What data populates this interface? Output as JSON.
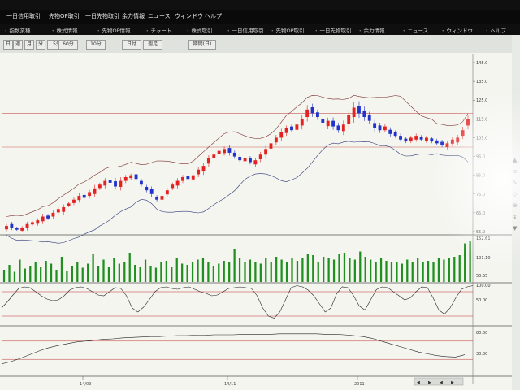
{
  "menu_top": {
    "items": [
      "一日信用取引",
      "先物OP取引",
      "一日先物取引",
      "余力情報",
      "ニュース",
      "ウィンドウ",
      "ヘルプ"
    ]
  },
  "menu_sub": {
    "items": [
      "指数業種",
      "株式情報",
      "先物OP情報",
      "チャート",
      "株式取引",
      "一日信用取引",
      "先物OP取引",
      "一日先物取引",
      "余力情報",
      "ニュース",
      "ウィンドウ",
      "ヘルプ"
    ]
  },
  "toolbar": {
    "buttons": [
      "日",
      "週",
      "月",
      "分",
      "5分",
      "60分",
      "10分",
      "日付",
      "週足"
    ],
    "right_label": "期間(日)"
  },
  "axis": {
    "price_ticks": [
      "145.0",
      "135.0",
      "125.0",
      "115.0",
      "105.0",
      "95.0",
      "85.0",
      "75.0",
      "65.0",
      "55.0"
    ],
    "volume_ticks": [
      "152.61",
      "101.10",
      "50.55"
    ],
    "osc1_ticks": [
      "100.00",
      "50.00"
    ],
    "osc2_ticks": [
      "80.00",
      "30.00"
    ],
    "date_labels": [
      "14/09",
      "14/11",
      "2011"
    ]
  },
  "colors": {
    "up": "#e52222",
    "down": "#2233cc",
    "band": "#333333",
    "volume": "#1f8f1f",
    "grid_red": "#c03030"
  },
  "chart_data": [
    {
      "type": "candlestick",
      "series": [
        {
          "name": "",
          "values": [
            58,
            57,
            56,
            57,
            59,
            60,
            61,
            63,
            62,
            65,
            67,
            68,
            70,
            72,
            74,
            73,
            76,
            78,
            80,
            82,
            81,
            79,
            82,
            84,
            85,
            83,
            80,
            77,
            75,
            72,
            74,
            77,
            80,
            82,
            84,
            83,
            85,
            88,
            90,
            94,
            96,
            98,
            99,
            97,
            95,
            93,
            94,
            92,
            93,
            96,
            99,
            102,
            105,
            108,
            110,
            109,
            112,
            115,
            120,
            118,
            116,
            113,
            114,
            111,
            109,
            112,
            117,
            121,
            118,
            116,
            114,
            110,
            109,
            111,
            107,
            106,
            104,
            103,
            105,
            106,
            104,
            105,
            103,
            102,
            101,
            102,
            104,
            105,
            109,
            115
          ]
        },
        {
          "name": "",
          "values": [
            1.8,
            2,
            1,
            1.5,
            2.2,
            1.2,
            1.8,
            2.5,
            1.5,
            2,
            1.8,
            2.5,
            1.2,
            1.8,
            2.2,
            1.5,
            2,
            3,
            1.8,
            2.5,
            1.5,
            2.8,
            3.2,
            2,
            1.5,
            2.5,
            2,
            1.8,
            2.5,
            1.5,
            2,
            2.2,
            1.8,
            2.5,
            2,
            1.8,
            2.2,
            2.5,
            3,
            2.8,
            2,
            1.8,
            2.2,
            2.5,
            2,
            1.8,
            1.5,
            2,
            2.2,
            2.5,
            3,
            2.8,
            2.5,
            3,
            2.5,
            2,
            2.8,
            3.5,
            4,
            3.2,
            2.5,
            2,
            2.8,
            3,
            2.5,
            3.5,
            4.5,
            5,
            4,
            3.5,
            3,
            2.8,
            2.5,
            2,
            2.2,
            1.8,
            2,
            1.5,
            1.8,
            2,
            1.5,
            1.8,
            1.6,
            1.5,
            1.8,
            2,
            2.2,
            2.5,
            3,
            3.5
          ]
        },
        {
          "name": "",
          "values": [
            1,
            -1,
            -1,
            1,
            1,
            1,
            1,
            1,
            -1,
            1,
            1,
            1,
            1,
            1,
            1,
            -1,
            1,
            1,
            1,
            1,
            -1,
            -1,
            1,
            1,
            1,
            -1,
            -1,
            -1,
            -1,
            -1,
            1,
            1,
            1,
            1,
            1,
            -1,
            1,
            1,
            1,
            1,
            1,
            1,
            1,
            -1,
            -1,
            -1,
            1,
            -1,
            1,
            1,
            1,
            1,
            1,
            1,
            1,
            -1,
            1,
            1,
            1,
            -1,
            -1,
            -1,
            1,
            -1,
            -1,
            1,
            1,
            1,
            -1,
            -1,
            -1,
            -1,
            -1,
            1,
            -1,
            -1,
            -1,
            -1,
            1,
            1,
            -1,
            1,
            -1,
            -1,
            -1,
            1,
            1,
            1,
            1,
            1
          ]
        }
      ],
      "ylim": [
        55,
        145
      ]
    },
    {
      "type": "bar",
      "series": [
        {
          "name": "",
          "values": [
            30,
            42,
            25,
            55,
            33,
            40,
            48,
            38,
            52,
            45,
            30,
            62,
            28,
            40,
            50,
            35,
            45,
            70,
            40,
            55,
            38,
            60,
            45,
            50,
            72,
            42,
            36,
            55,
            40,
            35,
            48,
            52,
            38,
            60,
            45,
            42,
            50,
            55,
            60,
            48,
            40,
            45,
            52,
            50,
            80,
            60,
            48,
            55,
            50,
            45,
            58,
            50,
            62,
            55,
            48,
            60,
            52,
            58,
            70,
            66,
            50,
            62,
            58,
            55,
            68,
            72,
            60,
            55,
            75,
            62,
            55,
            50,
            60,
            52,
            48,
            50,
            45,
            55,
            50,
            60,
            48,
            52,
            50,
            58,
            55,
            60,
            62,
            66,
            95,
            100
          ]
        }
      ]
    },
    {
      "type": "line",
      "series": [
        {
          "name": "",
          "values": [
            40,
            55,
            72,
            88,
            92,
            90,
            80,
            70,
            62,
            58,
            60,
            70,
            84,
            90,
            92,
            88,
            80,
            72,
            70,
            80,
            90,
            88,
            70,
            40,
            30,
            42,
            60,
            80,
            90,
            92,
            88,
            86,
            90,
            92,
            86,
            80,
            76,
            70,
            72,
            80,
            88,
            90,
            92,
            90,
            88,
            70,
            40,
            20,
            15,
            30,
            60,
            90,
            95,
            92,
            84,
            70,
            50,
            30,
            40,
            75,
            92,
            90,
            70,
            45,
            35,
            60,
            85,
            92,
            90,
            80,
            70,
            60,
            65,
            80,
            92,
            90,
            65,
            35,
            25,
            40,
            65,
            86,
            92,
            95
          ]
        }
      ]
    },
    {
      "type": "line",
      "series": [
        {
          "name": "",
          "values": [
            20,
            25,
            32,
            40,
            48,
            55,
            60,
            64,
            68,
            70,
            72,
            74,
            75,
            77,
            78,
            79,
            80,
            80,
            81,
            82,
            82,
            83,
            83,
            84,
            84,
            84,
            85,
            85,
            85,
            85,
            86,
            86,
            86,
            86,
            86,
            85,
            85,
            84,
            82,
            80,
            76,
            70,
            64,
            58,
            52,
            46,
            42,
            38,
            36,
            35,
            40
          ]
        }
      ]
    }
  ]
}
